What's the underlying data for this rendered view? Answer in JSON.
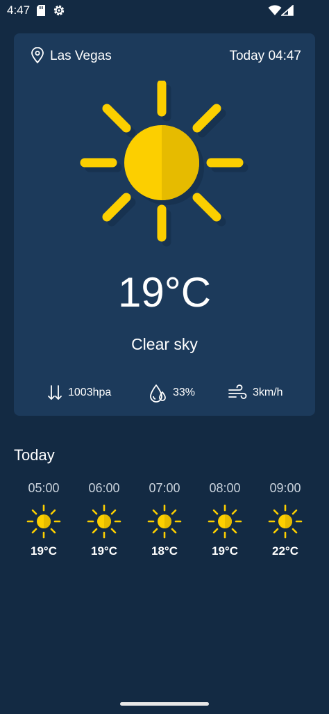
{
  "status_bar": {
    "time": "4:47",
    "icons": [
      "sd-card-icon",
      "gear-icon",
      "wifi-icon",
      "signal-icon"
    ]
  },
  "current": {
    "location": "Las Vegas",
    "datetime": "Today 04:47",
    "temperature": "19°C",
    "condition": "Clear sky",
    "icon": "sun-icon",
    "pressure": "1003hpa",
    "humidity": "33%",
    "wind": "3km/h"
  },
  "hourly": {
    "title": "Today",
    "items": [
      {
        "time": "05:00",
        "temp": "19°C",
        "icon": "sun-icon"
      },
      {
        "time": "06:00",
        "temp": "19°C",
        "icon": "sun-icon"
      },
      {
        "time": "07:00",
        "temp": "18°C",
        "icon": "sun-icon"
      },
      {
        "time": "08:00",
        "temp": "19°C",
        "icon": "sun-icon"
      },
      {
        "time": "09:00",
        "temp": "22°C",
        "icon": "sun-icon"
      }
    ]
  },
  "colors": {
    "background": "#132a43",
    "card": "#1c3a5b",
    "sun": "#fccf00",
    "sun_shade": "#e6bb00"
  }
}
